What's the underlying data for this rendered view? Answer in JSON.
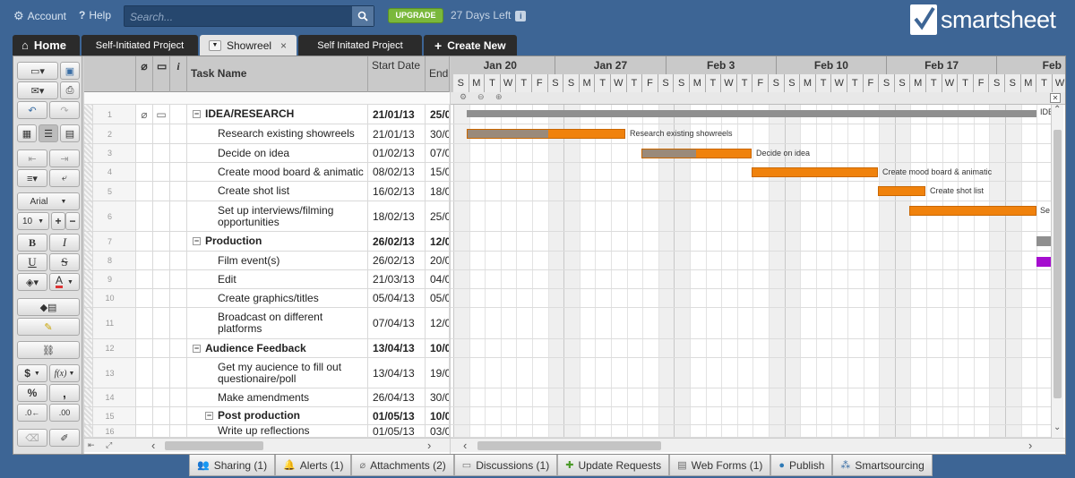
{
  "topbar": {
    "account": "Account",
    "help": "Help",
    "search_placeholder": "Search...",
    "upgrade": "UPGRADE",
    "days_left": "27 Days Left",
    "info": "i",
    "logo": "smartsheet"
  },
  "tabs": [
    {
      "label": "Home"
    },
    {
      "label": "Self-Initiated Project"
    },
    {
      "label": "Showreel",
      "close": "×"
    },
    {
      "label": "Self Initated Project"
    },
    {
      "label": "Create New"
    }
  ],
  "toolbar": {
    "font": "Arial",
    "size": "10",
    "bold": "B",
    "italic": "I",
    "underline": "U",
    "strike": "S",
    "color_a": "A",
    "dollar": "$",
    "fx": "f(x)",
    "percent": "%",
    "comma": ","
  },
  "columns": {
    "task": "Task Name",
    "start": "Start Date",
    "end": "End",
    "info": "i"
  },
  "rows": [
    {
      "num": "1",
      "task": "IDEA/RESEARCH",
      "start": "21/01/13",
      "end": "25/0",
      "bold": true,
      "level": 0,
      "toggle": "−"
    },
    {
      "num": "2",
      "task": "Research existing showreels",
      "start": "21/01/13",
      "end": "30/0",
      "level": 1
    },
    {
      "num": "3",
      "task": "Decide on idea",
      "start": "01/02/13",
      "end": "07/0",
      "level": 1
    },
    {
      "num": "4",
      "task": "Create mood board & animatic",
      "start": "08/02/13",
      "end": "15/0",
      "level": 1
    },
    {
      "num": "5",
      "task": "Create shot list",
      "start": "16/02/13",
      "end": "18/0",
      "level": 1
    },
    {
      "num": "6",
      "task": "Set up interviews/filming opportunities",
      "start": "18/02/13",
      "end": "25/0",
      "level": 1
    },
    {
      "num": "7",
      "task": "Production",
      "start": "26/02/13",
      "end": "12/0",
      "bold": true,
      "level": 0,
      "toggle": "−"
    },
    {
      "num": "8",
      "task": "Film event(s)",
      "start": "26/02/13",
      "end": "20/0",
      "level": 1
    },
    {
      "num": "9",
      "task": "Edit",
      "start": "21/03/13",
      "end": "04/0",
      "level": 1
    },
    {
      "num": "10",
      "task": "Create graphics/titles",
      "start": "05/04/13",
      "end": "05/0",
      "level": 1
    },
    {
      "num": "11",
      "task": "Broadcast on different platforms",
      "start": "07/04/13",
      "end": "12/0",
      "level": 1
    },
    {
      "num": "12",
      "task": "Audience Feedback",
      "start": "13/04/13",
      "end": "10/0",
      "bold": true,
      "level": 0,
      "toggle": "−"
    },
    {
      "num": "13",
      "task": "Get my aucience to fill out questionaire/poll",
      "start": "13/04/13",
      "end": "19/0",
      "level": 1
    },
    {
      "num": "14",
      "task": "Make amendments",
      "start": "26/04/13",
      "end": "30/0",
      "level": 1
    },
    {
      "num": "15",
      "task": "Post production",
      "start": "01/05/13",
      "end": "10/0",
      "bold": true,
      "level": 0.5,
      "toggle": "−"
    },
    {
      "num": "16",
      "task": "Write up reflections",
      "start": "01/05/13",
      "end": "03/0",
      "level": 1
    }
  ],
  "gantt": {
    "weeks": [
      "Jan 20",
      "Jan 27",
      "Feb 3",
      "Feb 10",
      "Feb 17",
      "Feb"
    ],
    "days": [
      "S",
      "M",
      "T",
      "W",
      "T",
      "F",
      "S"
    ],
    "labels": {
      "r1": "IDE",
      "r2": "Research existing showreels",
      "r3": "Decide on idea",
      "r4": "Create mood board & animatic",
      "r5": "Create shot list",
      "r6": "Se"
    }
  },
  "bottom_tabs": [
    {
      "label": "Sharing (1)",
      "icon": "users-icon"
    },
    {
      "label": "Alerts (1)",
      "icon": "bell-icon"
    },
    {
      "label": "Attachments (2)",
      "icon": "paperclip-icon"
    },
    {
      "label": "Discussions (1)",
      "icon": "chat-icon"
    },
    {
      "label": "Update Requests",
      "icon": "update-request-icon"
    },
    {
      "label": "Web Forms (1)",
      "icon": "form-icon"
    },
    {
      "label": "Publish",
      "icon": "globe-icon"
    },
    {
      "label": "Smartsourcing",
      "icon": "smartsourcing-icon"
    }
  ]
}
